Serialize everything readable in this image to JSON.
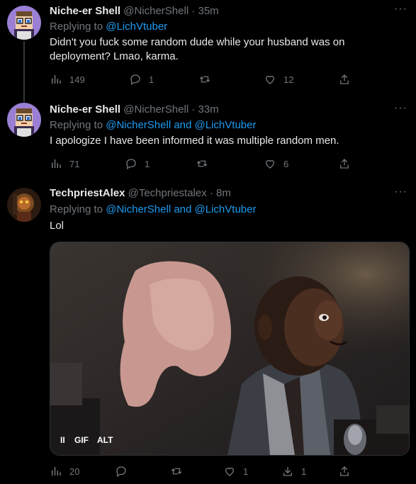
{
  "tweets": [
    {
      "name": "Niche-er Shell",
      "handle": "@NicherShell · 35m",
      "replying_prefix": "Replying to ",
      "replying_to": "@LichVtuber",
      "replying_and": "",
      "replying_to2": "",
      "text": "Didn't you fuck some random dude while your husband was on deployment? Lmao, karma.",
      "views": "149",
      "replies": "1",
      "retweets": "",
      "likes": "12"
    },
    {
      "name": "Niche-er Shell",
      "handle": "@NicherShell · 33m",
      "replying_prefix": "Replying to ",
      "replying_to": "@NicherShell",
      "replying_and": " and ",
      "replying_to2": "@LichVtuber",
      "text": "I apologize I have been informed it was multiple random men.",
      "views": "71",
      "replies": "1",
      "retweets": "",
      "likes": "6"
    },
    {
      "name": "TechpriestAlex",
      "handle": "@Techpriestalex · 8m",
      "replying_prefix": "Replying to ",
      "replying_to": "@NicherShell",
      "replying_and": " and ",
      "replying_to2": "@LichVtuber",
      "text": "Lol",
      "views": "20",
      "replies": "",
      "retweets": "",
      "likes": "1",
      "downloads": "1",
      "media": {
        "pause_label": "II",
        "gif_label": "GIF",
        "alt_label": "ALT"
      }
    }
  ],
  "more_label": "···",
  "colors": {
    "accent": "#1d9bf0",
    "muted": "#71767b",
    "text": "#e7e9ea",
    "bg": "#000000"
  }
}
